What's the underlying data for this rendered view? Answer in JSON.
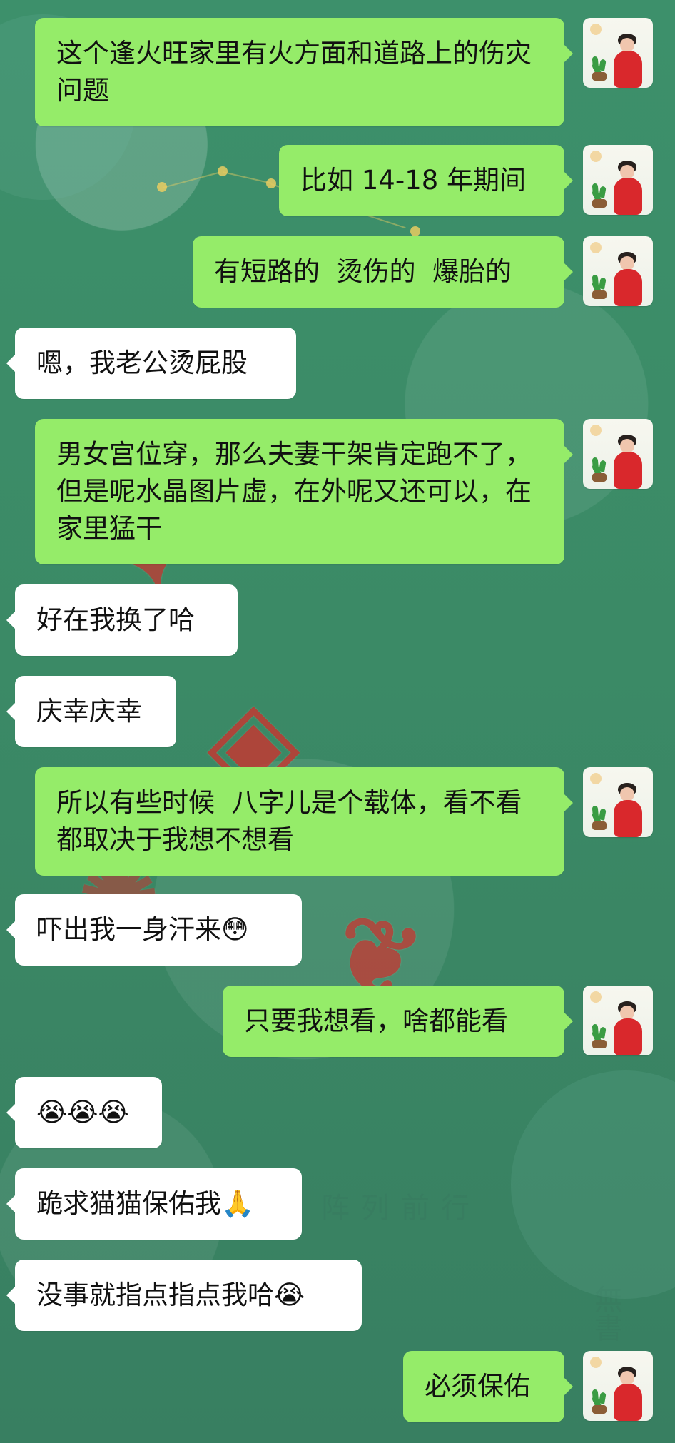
{
  "messages": [
    {
      "sender": "me",
      "text": "这个逢火旺家里有火方面和道路上的伤灾问题"
    },
    {
      "sender": "me",
      "text": "比如 14-18 年期间"
    },
    {
      "sender": "me",
      "text": "有短路的  烫伤的  爆胎的"
    },
    {
      "sender": "other",
      "text": "嗯，我老公烫屁股"
    },
    {
      "sender": "me",
      "text": "男女宫位穿，那么夫妻干架肯定跑不了，但是呢水晶图片虚，在外呢又还可以，在家里猛干"
    },
    {
      "sender": "other",
      "text": "好在我换了哈"
    },
    {
      "sender": "other",
      "text": "庆幸庆幸"
    },
    {
      "sender": "me",
      "text": "所以有些时候  八字儿是个载体，看不看都取决于我想不想看"
    },
    {
      "sender": "other",
      "text": "吓出我一身汗来😳"
    },
    {
      "sender": "me",
      "text": "只要我想看，啥都能看"
    },
    {
      "sender": "other",
      "text": "😭😭😭"
    },
    {
      "sender": "other",
      "text": "跪求猫猫保佑我🙏"
    },
    {
      "sender": "other",
      "text": "没事就指点指点我哈😭"
    },
    {
      "sender": "me",
      "text": "必须保佑"
    }
  ],
  "background_text": {
    "line_1": "阵列前行",
    "line_2": "無書"
  }
}
